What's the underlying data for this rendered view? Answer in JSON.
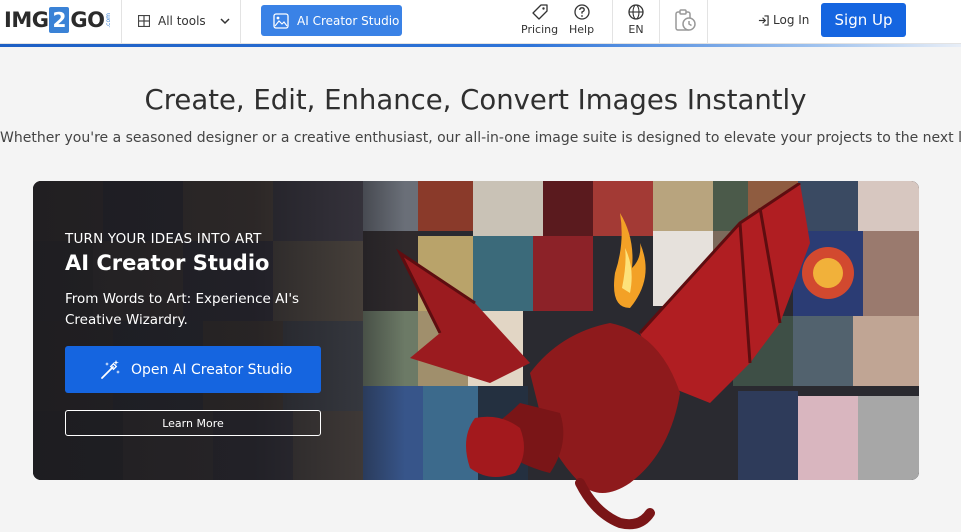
{
  "header": {
    "logo": {
      "part1": "IMG",
      "part2": "2",
      "part3": "GO",
      "suffix": ".com"
    },
    "all_tools_label": "All tools",
    "ai_creator_label": "AI Creator Studio",
    "nav": [
      {
        "label": "Pricing",
        "icon": "tag-icon"
      },
      {
        "label": "Help",
        "icon": "question-icon"
      },
      {
        "label": "EN",
        "icon": "globe-icon"
      }
    ],
    "clipboard_icon": "clipboard-clock-icon",
    "login_label": "Log In",
    "signup_label": "Sign Up",
    "colors": {
      "accent": "#1565e0",
      "ai_button": "#3a82e6"
    }
  },
  "hero": {
    "title": "Create, Edit, Enhance, Convert Images Instantly",
    "subtitle": "Whether you're a seasoned designer or a creative enthusiast, our all-in-one image suite is designed to elevate your projects to the next level."
  },
  "banner": {
    "eyebrow": "TURN YOUR IDEAS INTO ART",
    "title": "AI Creator Studio",
    "description": "From Words to Art: Experience AI's Creative Wizardry.",
    "primary_button": "Open AI Creator Studio",
    "secondary_button": "Learn More"
  }
}
